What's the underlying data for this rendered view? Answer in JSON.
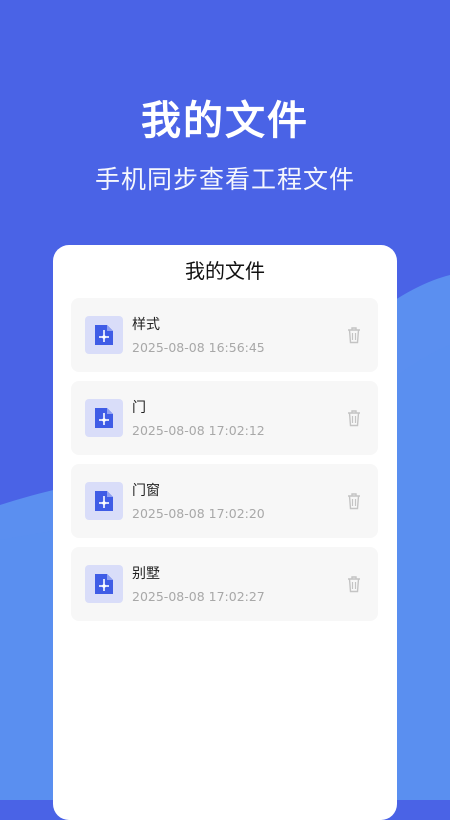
{
  "colors": {
    "background": "#4a63e6",
    "wave_light": "#5b8ff0",
    "accent": "#3f5ce6",
    "icon_bg": "#d9ddf9"
  },
  "hero": {
    "title": "我的文件",
    "subtitle": "手机同步查看工程文件"
  },
  "card": {
    "title": "我的文件"
  },
  "files": [
    {
      "name": "样式",
      "date": "2025-08-08 16:56:45",
      "icon": "cad-file-icon"
    },
    {
      "name": "门",
      "date": "2025-08-08 17:02:12",
      "icon": "cad-file-icon"
    },
    {
      "name": "门窗",
      "date": "2025-08-08 17:02:20",
      "icon": "cad-file-icon"
    },
    {
      "name": "别墅",
      "date": "2025-08-08 17:02:27",
      "icon": "cad-file-icon"
    }
  ]
}
